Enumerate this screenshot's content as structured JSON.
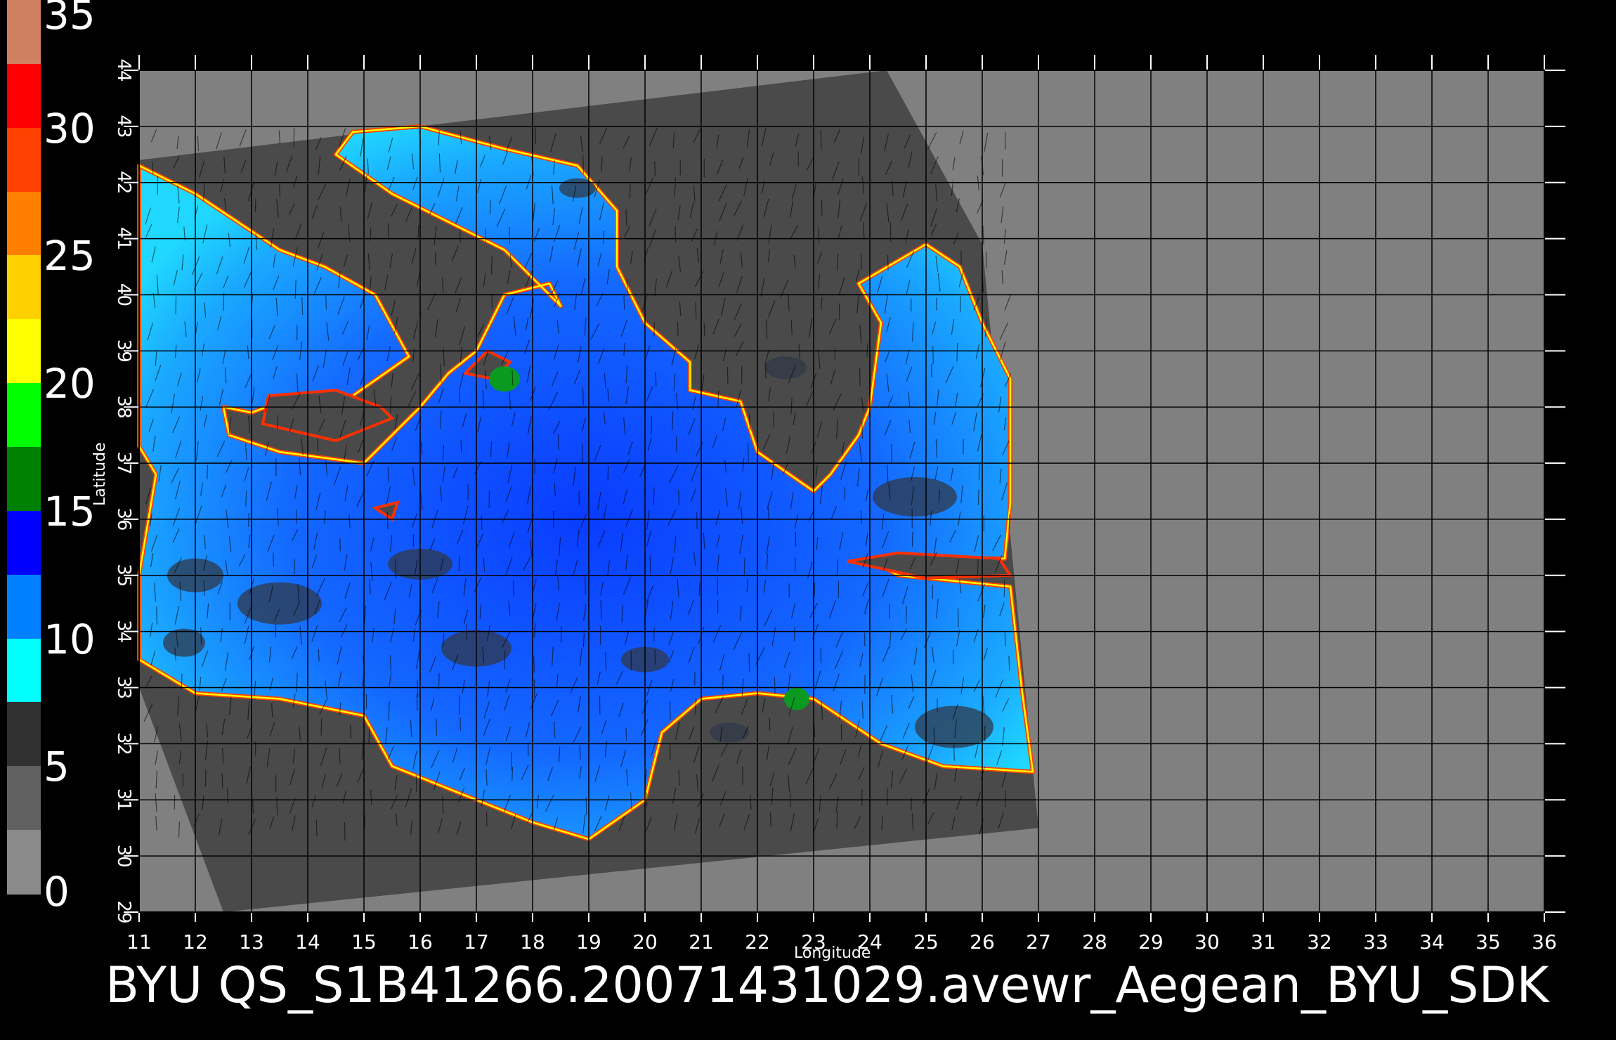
{
  "colorbar": {
    "labels": [
      "0",
      "5",
      "10",
      "15",
      "20",
      "25",
      "30",
      "35"
    ],
    "values": [
      0,
      5,
      10,
      15,
      20,
      25,
      30,
      35
    ],
    "colors": [
      "#8a8a8a",
      "#606060",
      "#303030",
      "#00ffff",
      "#0080ff",
      "#0000ff",
      "#008000",
      "#00ff00",
      "#ffff00",
      "#ffd000",
      "#ff8000",
      "#ff4000",
      "#ff0000",
      "#d08060"
    ]
  },
  "axes": {
    "xlabel": "Longitude",
    "ylabel": "Latitude",
    "xticks": [
      "11",
      "12",
      "13",
      "14",
      "15",
      "16",
      "17",
      "18",
      "19",
      "20",
      "21",
      "22",
      "23",
      "24",
      "25",
      "26",
      "27",
      "28",
      "29",
      "30",
      "31",
      "32",
      "33",
      "34",
      "35",
      "36"
    ],
    "yticks": [
      "29",
      "30",
      "31",
      "32",
      "33",
      "34",
      "35",
      "36",
      "37",
      "38",
      "39",
      "40",
      "41",
      "42",
      "43",
      "44"
    ],
    "xlim": [
      11,
      36
    ],
    "ylim": [
      29,
      44
    ],
    "grid": true
  },
  "footer": {
    "title": "BYU  QS_S1B41266.20071431029.avewr_Aegean_BYU_SDK"
  },
  "colors": {
    "background": "#000000",
    "land": "#808080",
    "swath": "#4a4a4a",
    "grid": "#000000"
  }
}
